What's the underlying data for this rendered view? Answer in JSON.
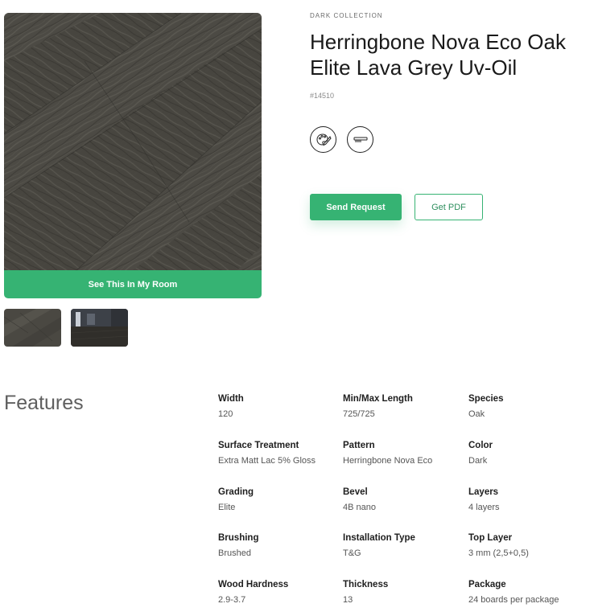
{
  "product": {
    "collection": "DARK COLLECTION",
    "title": "Herringbone Nova Eco Oak Elite Lava Grey Uv-Oil",
    "sku": "#14510"
  },
  "gallery": {
    "see_in_room_label": "See This In My Room"
  },
  "icons": [
    "palette-brush-icon",
    "comb-brush-icon"
  ],
  "actions": {
    "send_request_label": "Send Request",
    "get_pdf_label": "Get PDF"
  },
  "colors": {
    "accent": "#36b373",
    "wood": "#4b4943"
  },
  "features": {
    "heading": "Features",
    "specs": [
      {
        "label": "Width",
        "value": "120"
      },
      {
        "label": "Min/Max Length",
        "value": "725/725"
      },
      {
        "label": "Species",
        "value": "Oak"
      },
      {
        "label": "Surface Treatment",
        "value": "Extra Matt Lac 5% Gloss"
      },
      {
        "label": "Pattern",
        "value": "Herringbone Nova Eco"
      },
      {
        "label": "Color",
        "value": "Dark"
      },
      {
        "label": "Grading",
        "value": "Elite"
      },
      {
        "label": "Bevel",
        "value": "4B nano"
      },
      {
        "label": "Layers",
        "value": "4 layers"
      },
      {
        "label": "Brushing",
        "value": "Brushed"
      },
      {
        "label": "Installation Type",
        "value": "T&G"
      },
      {
        "label": "Top Layer",
        "value": "3 mm (2,5+0,5)"
      },
      {
        "label": "Wood Hardness",
        "value": "2.9-3.7"
      },
      {
        "label": "Thickness",
        "value": "13"
      },
      {
        "label": "Package",
        "value": "24 boards per package"
      }
    ]
  }
}
